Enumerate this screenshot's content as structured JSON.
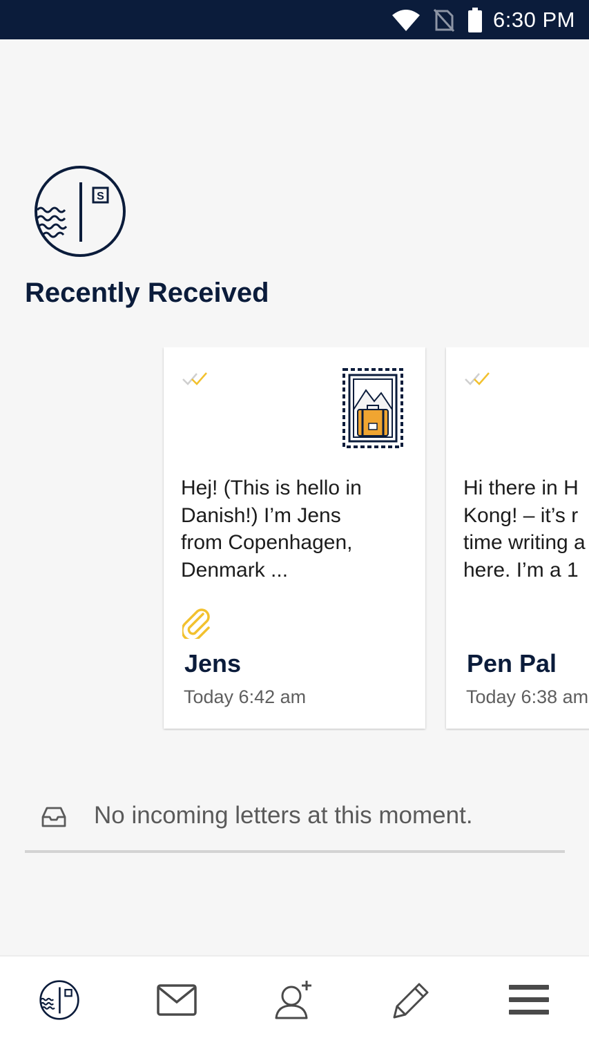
{
  "status_bar": {
    "time": "6:30 PM",
    "icons": [
      "wifi-icon",
      "no-sim-icon",
      "battery-icon"
    ],
    "background": "#0b1c3b"
  },
  "app": {
    "logo": "postcard-logo-icon",
    "logo_letter": "S",
    "accent": "#f2c12e",
    "primary": "#0b1c3b"
  },
  "recently_received": {
    "title": "Recently Received",
    "letters": [
      {
        "preview": "Hej! (This is hello in\nDanish!) I’m Jens\nfrom Copenhagen,\nDenmark ...",
        "sender": "Jens",
        "date": "Today 6:42 am",
        "has_attachment": true,
        "stamp": "travel-stamp-icon",
        "status": "read-check-icon"
      },
      {
        "preview": "Hi there in H\nKong! – it’s r\ntime writing a\nhere. I’m a 1",
        "sender": "Pen Pal",
        "date": "Today 6:38 am",
        "has_attachment": false,
        "status": "read-check-icon"
      }
    ]
  },
  "incoming": {
    "empty_message": "No incoming letters at this moment.",
    "icon": "inbox-tray-icon"
  },
  "bottom_nav": {
    "items": [
      "home-logo-icon",
      "mail-icon",
      "add-friend-icon",
      "compose-pencil-icon",
      "menu-icon"
    ]
  }
}
